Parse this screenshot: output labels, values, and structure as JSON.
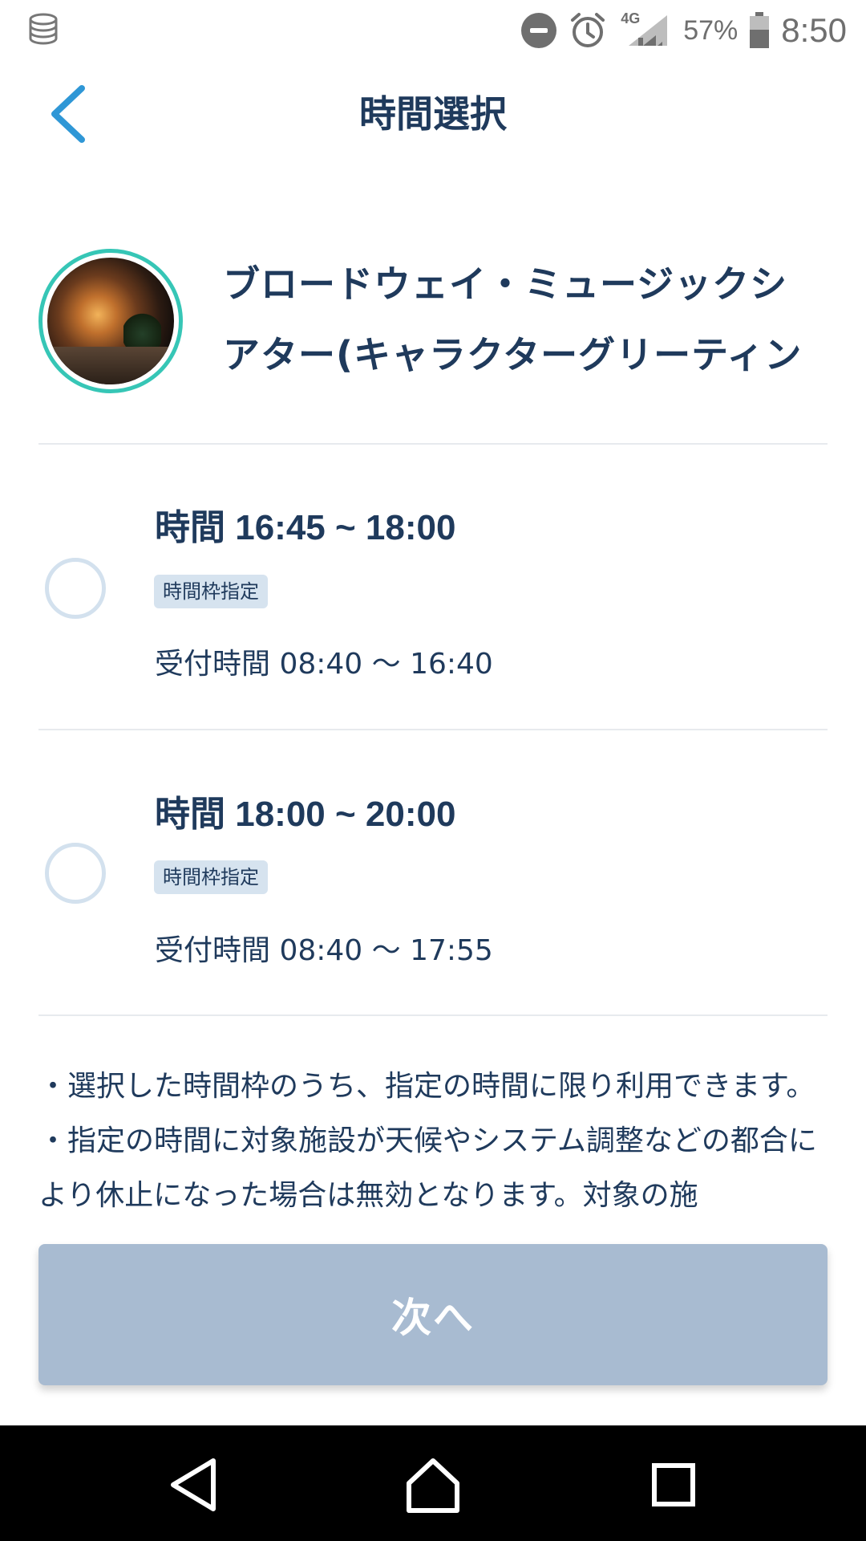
{
  "status_bar": {
    "battery_percent": "57%",
    "time": "8:50",
    "network": "4G",
    "icons": [
      "storage-icon",
      "do-not-disturb-icon",
      "alarm-icon",
      "signal-icon",
      "battery-icon"
    ]
  },
  "header": {
    "title": "時間選択",
    "back_icon": "chevron-left-icon"
  },
  "attraction": {
    "name": "ブロードウェイ・ミュージックシアター(キャラクターグリーティング)",
    "accent_color": "#36c6b6"
  },
  "slots": [
    {
      "label_prefix": "時間",
      "time_range": "16:45 ~ 18:00",
      "badge": "時間枠指定",
      "reception": "受付時間 08:40 〜 16:40",
      "selected": false
    },
    {
      "label_prefix": "時間",
      "time_range": "18:00 ~ 20:00",
      "badge": "時間枠指定",
      "reception": "受付時間 08:40 〜 17:55",
      "selected": false
    }
  ],
  "notes": [
    "・選択した時間枠のうち、指定の時間に限り利用できます。",
    "・指定の時間に対象施設が天候やシステム調整などの都合により休止になった場合は無効となります。対象の施"
  ],
  "next_button": {
    "label": "次へ",
    "enabled": false,
    "color": "#a8bbd1"
  },
  "nav_bar": {
    "icons": [
      "back-triangle-icon",
      "home-icon",
      "recents-icon"
    ]
  },
  "colors": {
    "text_primary": "#1f3a5c",
    "link": "#2f97d6",
    "badge_bg": "#d6e3ef",
    "radio_border": "#d3e1ee"
  }
}
